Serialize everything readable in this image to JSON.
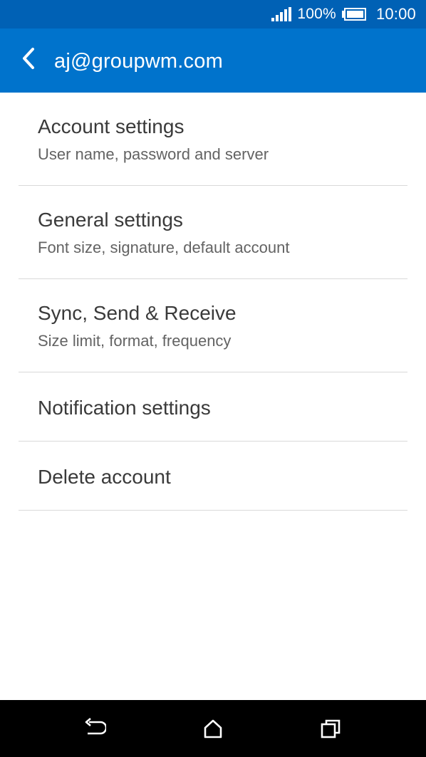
{
  "status_bar": {
    "battery_percent": "100%",
    "time": "10:00",
    "icons": [
      "signal-icon",
      "battery-icon"
    ]
  },
  "header": {
    "title": "aj@groupwm.com",
    "back_icon": "chevron-left-icon",
    "background": "#0073cc"
  },
  "settings": {
    "items": [
      {
        "title": "Account settings",
        "subtitle": "User name, password and server"
      },
      {
        "title": "General settings",
        "subtitle": "Font size, signature, default account"
      },
      {
        "title": "Sync, Send & Receive",
        "subtitle": "Size limit, format, frequency"
      },
      {
        "title": "Notification settings"
      },
      {
        "title": "Delete account"
      }
    ]
  },
  "nav_bar": {
    "icons": [
      "back-icon",
      "home-icon",
      "recent-apps-icon"
    ]
  },
  "colors": {
    "status_bar": "#0061b5",
    "action_bar": "#0073cc",
    "divider": "#d9d9d9",
    "nav_bar": "#000000"
  }
}
